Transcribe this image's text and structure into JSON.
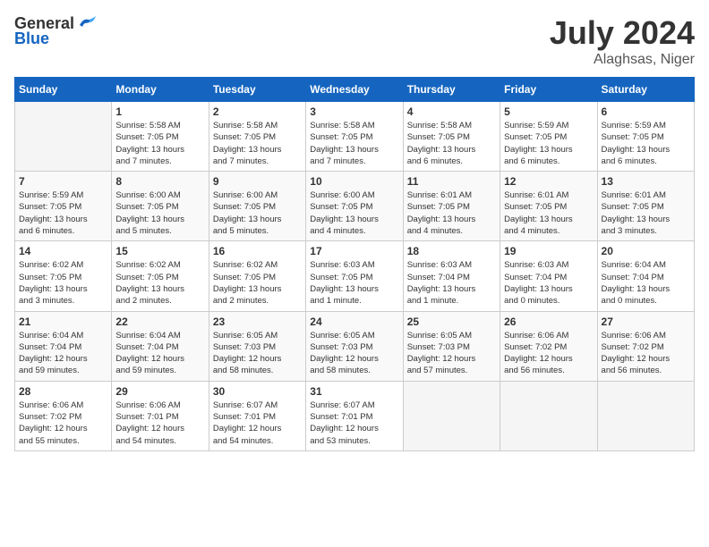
{
  "header": {
    "logo_general": "General",
    "logo_blue": "Blue",
    "month_year": "July 2024",
    "location": "Alaghsas, Niger"
  },
  "days_of_week": [
    "Sunday",
    "Monday",
    "Tuesday",
    "Wednesday",
    "Thursday",
    "Friday",
    "Saturday"
  ],
  "weeks": [
    [
      {
        "day": "",
        "info": ""
      },
      {
        "day": "1",
        "info": "Sunrise: 5:58 AM\nSunset: 7:05 PM\nDaylight: 13 hours\nand 7 minutes."
      },
      {
        "day": "2",
        "info": "Sunrise: 5:58 AM\nSunset: 7:05 PM\nDaylight: 13 hours\nand 7 minutes."
      },
      {
        "day": "3",
        "info": "Sunrise: 5:58 AM\nSunset: 7:05 PM\nDaylight: 13 hours\nand 7 minutes."
      },
      {
        "day": "4",
        "info": "Sunrise: 5:58 AM\nSunset: 7:05 PM\nDaylight: 13 hours\nand 6 minutes."
      },
      {
        "day": "5",
        "info": "Sunrise: 5:59 AM\nSunset: 7:05 PM\nDaylight: 13 hours\nand 6 minutes."
      },
      {
        "day": "6",
        "info": "Sunrise: 5:59 AM\nSunset: 7:05 PM\nDaylight: 13 hours\nand 6 minutes."
      }
    ],
    [
      {
        "day": "7",
        "info": "Sunrise: 5:59 AM\nSunset: 7:05 PM\nDaylight: 13 hours\nand 6 minutes."
      },
      {
        "day": "8",
        "info": "Sunrise: 6:00 AM\nSunset: 7:05 PM\nDaylight: 13 hours\nand 5 minutes."
      },
      {
        "day": "9",
        "info": "Sunrise: 6:00 AM\nSunset: 7:05 PM\nDaylight: 13 hours\nand 5 minutes."
      },
      {
        "day": "10",
        "info": "Sunrise: 6:00 AM\nSunset: 7:05 PM\nDaylight: 13 hours\nand 4 minutes."
      },
      {
        "day": "11",
        "info": "Sunrise: 6:01 AM\nSunset: 7:05 PM\nDaylight: 13 hours\nand 4 minutes."
      },
      {
        "day": "12",
        "info": "Sunrise: 6:01 AM\nSunset: 7:05 PM\nDaylight: 13 hours\nand 4 minutes."
      },
      {
        "day": "13",
        "info": "Sunrise: 6:01 AM\nSunset: 7:05 PM\nDaylight: 13 hours\nand 3 minutes."
      }
    ],
    [
      {
        "day": "14",
        "info": "Sunrise: 6:02 AM\nSunset: 7:05 PM\nDaylight: 13 hours\nand 3 minutes."
      },
      {
        "day": "15",
        "info": "Sunrise: 6:02 AM\nSunset: 7:05 PM\nDaylight: 13 hours\nand 2 minutes."
      },
      {
        "day": "16",
        "info": "Sunrise: 6:02 AM\nSunset: 7:05 PM\nDaylight: 13 hours\nand 2 minutes."
      },
      {
        "day": "17",
        "info": "Sunrise: 6:03 AM\nSunset: 7:05 PM\nDaylight: 13 hours\nand 1 minute."
      },
      {
        "day": "18",
        "info": "Sunrise: 6:03 AM\nSunset: 7:04 PM\nDaylight: 13 hours\nand 1 minute."
      },
      {
        "day": "19",
        "info": "Sunrise: 6:03 AM\nSunset: 7:04 PM\nDaylight: 13 hours\nand 0 minutes."
      },
      {
        "day": "20",
        "info": "Sunrise: 6:04 AM\nSunset: 7:04 PM\nDaylight: 13 hours\nand 0 minutes."
      }
    ],
    [
      {
        "day": "21",
        "info": "Sunrise: 6:04 AM\nSunset: 7:04 PM\nDaylight: 12 hours\nand 59 minutes."
      },
      {
        "day": "22",
        "info": "Sunrise: 6:04 AM\nSunset: 7:04 PM\nDaylight: 12 hours\nand 59 minutes."
      },
      {
        "day": "23",
        "info": "Sunrise: 6:05 AM\nSunset: 7:03 PM\nDaylight: 12 hours\nand 58 minutes."
      },
      {
        "day": "24",
        "info": "Sunrise: 6:05 AM\nSunset: 7:03 PM\nDaylight: 12 hours\nand 58 minutes."
      },
      {
        "day": "25",
        "info": "Sunrise: 6:05 AM\nSunset: 7:03 PM\nDaylight: 12 hours\nand 57 minutes."
      },
      {
        "day": "26",
        "info": "Sunrise: 6:06 AM\nSunset: 7:02 PM\nDaylight: 12 hours\nand 56 minutes."
      },
      {
        "day": "27",
        "info": "Sunrise: 6:06 AM\nSunset: 7:02 PM\nDaylight: 12 hours\nand 56 minutes."
      }
    ],
    [
      {
        "day": "28",
        "info": "Sunrise: 6:06 AM\nSunset: 7:02 PM\nDaylight: 12 hours\nand 55 minutes."
      },
      {
        "day": "29",
        "info": "Sunrise: 6:06 AM\nSunset: 7:01 PM\nDaylight: 12 hours\nand 54 minutes."
      },
      {
        "day": "30",
        "info": "Sunrise: 6:07 AM\nSunset: 7:01 PM\nDaylight: 12 hours\nand 54 minutes."
      },
      {
        "day": "31",
        "info": "Sunrise: 6:07 AM\nSunset: 7:01 PM\nDaylight: 12 hours\nand 53 minutes."
      },
      {
        "day": "",
        "info": ""
      },
      {
        "day": "",
        "info": ""
      },
      {
        "day": "",
        "info": ""
      }
    ]
  ]
}
